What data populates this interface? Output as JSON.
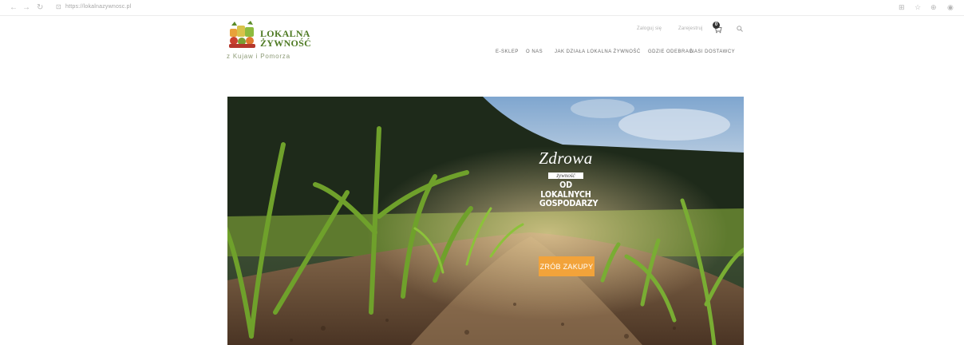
{
  "browser": {
    "url": "https://lokalnazywnosc.pl",
    "back_icon": "arrow-left-icon",
    "forward_icon": "arrow-right-icon",
    "reload_icon": "reload-icon"
  },
  "logo": {
    "line1": "LOKALNA",
    "line2": "ŻYWNOŚĆ",
    "subtitle": "z Kujaw i Pomorza"
  },
  "utility_nav": {
    "login": "Zaloguj się",
    "register": "Zarejestruj",
    "cart_count": "0"
  },
  "main_nav": {
    "items": [
      "E-SKLEP",
      "O NAS",
      "JAK DZIAŁA LOKALNA ŻYWNOŚĆ",
      "GDZIE ODEBRAĆ",
      "NASI DOSTAWCY"
    ]
  },
  "hero": {
    "slogan_line1": "Zdrowa",
    "slogan_line2": "żywność",
    "slogan_line3": "OD LOKALNYCH",
    "slogan_line4": "GOSPODARZY",
    "cta_label": "ZRÓB ZAKUPY",
    "cta_color": "#f2a33a"
  }
}
